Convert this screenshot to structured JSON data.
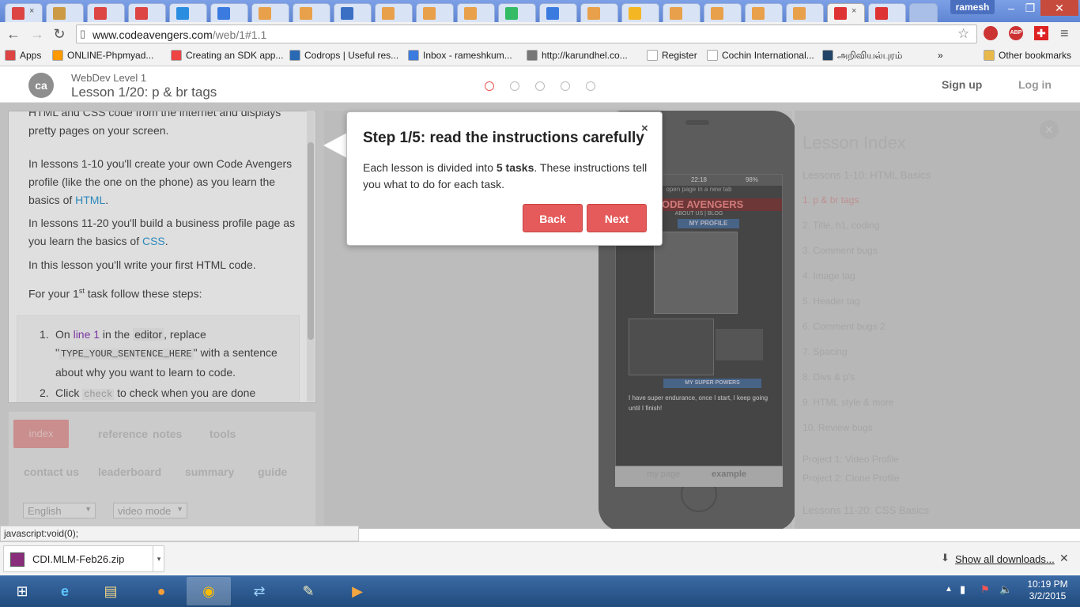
{
  "browser": {
    "user": "ramesh",
    "active_tab_favicon": "codeavengers-icon",
    "url_host": "www.codeavengers.com",
    "url_path": "/web/1#1.1",
    "bookmarks": [
      {
        "label": "Apps",
        "icon": "apps-grid-icon",
        "color": "#d44"
      },
      {
        "label": "ONLINE-Phpmyad...",
        "icon": "pma-icon",
        "color": "#f90"
      },
      {
        "label": "Creating an SDK app...",
        "icon": "sdk-icon",
        "color": "#e44"
      },
      {
        "label": "Codrops | Useful res...",
        "icon": "codrops-icon",
        "color": "#2a6ab5"
      },
      {
        "label": "Inbox - rameshkum...",
        "icon": "google-icon",
        "color": "#3b7be0"
      },
      {
        "label": "http://karundhel.co...",
        "icon": "gun-icon",
        "color": "#777"
      },
      {
        "label": "Register",
        "icon": "page-icon",
        "color": "#fff"
      },
      {
        "label": "Cochin International...",
        "icon": "page-icon",
        "color": "#fff"
      },
      {
        "label": "அறிவியல்புரம்",
        "icon": "globe-icon",
        "color": "#246"
      },
      {
        "label": "»",
        "icon": "page-icon",
        "color": "#fff"
      },
      {
        "label": "Other bookmarks",
        "icon": "folder-icon",
        "color": "#e8b94a"
      }
    ]
  },
  "site": {
    "level": "WebDev Level 1",
    "lesson": "Lesson 1/20: p & br tags",
    "signup": "Sign up",
    "login": "Log in"
  },
  "instructions": {
    "p0": "HTML and CSS code from the internet and displays pretty pages on your screen.",
    "p1a": "In lessons 1-10 you'll create your own Code Avengers profile (like the one on the phone) as you learn the basics of ",
    "p1link": "HTML",
    "p2a": "In lessons 11-20 you'll build a business profile page as you learn the basics of ",
    "p2link": "CSS",
    "p3": "In this lesson you'll write your first HTML code.",
    "p4a": "For your 1",
    "p4sup": "st",
    "p4b": " task follow these steps:",
    "step1a": "On ",
    "step1line": "line 1",
    "step1b": " in the ",
    "step1editor": "editor",
    "step1c": ", replace \"",
    "step1code": "TYPE_YOUR_SENTENCE_HERE",
    "step1d": "\" with a sentence about why you want to learn to code.",
    "step2a": "Click ",
    "step2code": "check",
    "step2b": " to check when you are done"
  },
  "bottom_panel": {
    "tabs": [
      "index",
      "reference",
      "notes",
      "tools"
    ],
    "links": [
      "contact us",
      "leaderboard",
      "summary",
      "guide"
    ],
    "language": "English",
    "mode": "video mode"
  },
  "phone": {
    "time": "22:18",
    "battery": "98%",
    "open_page": "open page in a new tab",
    "brand": "CODE AVENGERS",
    "nav": "ABOUT US | BLOG",
    "profile": "MY PROFILE",
    "powers": "MY SUPER POWERS",
    "powers_text": "I have super endurance, once I start, I keep going until I finish!",
    "tab_mypage": "my page",
    "tab_example": "example"
  },
  "lesson_index": {
    "title": "Lesson Index",
    "section1": "Lessons 1-10: HTML Basics",
    "items": [
      "1. p & br tags",
      "2. Title, h1, coding",
      "3. Comment bugs",
      "4. Image tag",
      "5. Header tag",
      "6. Comment bugs 2",
      "7. Spacing",
      "8. Divs & p's",
      "9. HTML style & more",
      "10. Review bugs"
    ],
    "projects": [
      "Project 1: Video Profile",
      "Project 2: Clone Profile"
    ],
    "section2": "Lessons 11-20: CSS Basics"
  },
  "tour": {
    "title": "Step 1/5: read the instructions carefully",
    "close": "×",
    "body_a": "Each lesson is divided into ",
    "body_bold": "5 tasks",
    "body_b": ". These instructions tell you what to do for each task.",
    "back": "Back",
    "next": "Next"
  },
  "status": "javascript:void(0);",
  "downloads": {
    "file": "CDI.MLM-Feb26.zip",
    "show_all": "Show all downloads..."
  },
  "taskbar": {
    "time": "10:19 PM",
    "date": "3/2/2015"
  },
  "colors": {
    "accent": "#e55a5a",
    "link": "#2e9bd6",
    "purple": "#8a39b8"
  }
}
